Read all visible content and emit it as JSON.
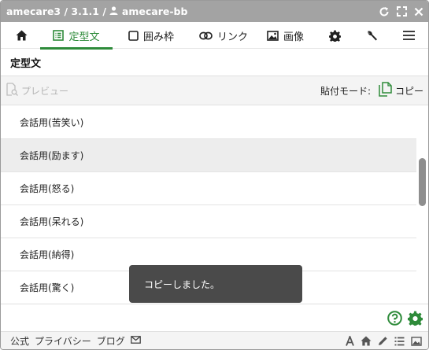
{
  "window": {
    "title_app": "amecare3 / 3.1.1 /",
    "title_user": "amecare-bb"
  },
  "tabs": [
    {
      "label": "",
      "icon": "home-icon"
    },
    {
      "label": "定型文",
      "icon": "template-list-icon",
      "active": true
    },
    {
      "label": "囲み枠",
      "icon": "frame-box-icon"
    },
    {
      "label": "リンク",
      "icon": "link-icon"
    },
    {
      "label": "画像",
      "icon": "image-icon"
    },
    {
      "label": "",
      "icon": "gear-icon"
    },
    {
      "label": "",
      "icon": "wrench-icon"
    },
    {
      "label": "",
      "icon": "hamburger-menu-icon"
    }
  ],
  "section": {
    "title": "定型文"
  },
  "toolbar": {
    "preview_label": "プレビュー",
    "paste_mode_label": "貼付モード:",
    "copy_label": "コピー"
  },
  "list": {
    "items": [
      {
        "label": "会話用(苦笑い)"
      },
      {
        "label": "会話用(励ます)",
        "hover": true
      },
      {
        "label": "会話用(怒る)"
      },
      {
        "label": "会話用(呆れる)"
      },
      {
        "label": "会話用(納得)"
      },
      {
        "label": "会話用(驚く)"
      }
    ]
  },
  "toast": {
    "message": "コピーしました。"
  },
  "footer": {
    "links": [
      "公式",
      "プライバシー",
      "ブログ"
    ]
  },
  "colors": {
    "accent": "#2e8b3a",
    "titlebar": "#a3a3a3",
    "toast_bg": "#4a4a4a"
  }
}
